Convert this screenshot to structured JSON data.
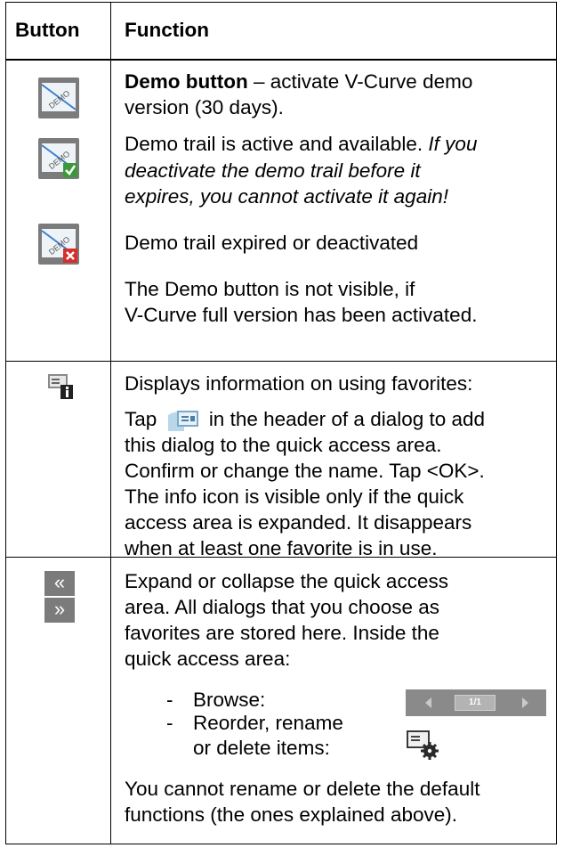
{
  "header": {
    "button_col": "Button",
    "function_col": "Function"
  },
  "demo": {
    "title": "Demo button",
    "title_rest": " – activate V-Curve demo",
    "title_line2": "version (30 days).",
    "active_line1": "Demo trail is active and available. ",
    "active_italic1": "If you",
    "active_line2": "deactivate the demo trail before it",
    "active_line3": "expires, you cannot activate it again!",
    "expired": "Demo trail expired or deactivated",
    "note_line1": "The Demo button is not visible, if",
    "note_line2": "V-Curve full version has been activated.",
    "icon_text": "DEMO"
  },
  "favorites": {
    "line1": "Displays information on using favorites:",
    "line2a": "Tap",
    "line2b": "in the header of a dialog to add",
    "line3": "this dialog to the quick access area.",
    "line4": "Confirm or change the name. Tap <OK>.",
    "line5": "The info icon is visible only if the quick",
    "line6": "access area is expanded. It disappears",
    "line7": "when at least one favorite is in use."
  },
  "quick_access": {
    "expand_glyph": "«",
    "collapse_glyph": "»",
    "line1": "Expand or collapse the quick access",
    "line2": "area. All dialogs that you choose as",
    "line3": "favorites are stored here. Inside the",
    "line4": "quick access area:",
    "dash": "-",
    "browse": "Browse:",
    "reorder1": "Reorder, rename",
    "reorder2": "or delete items:",
    "page_indicator": "1/1",
    "note1": "You cannot rename or delete the default",
    "note2": "functions (the ones explained above)."
  },
  "colors": {
    "icon_grey": "#7b7b7b",
    "check_green": "#3a9a3a",
    "x_red": "#d62d2d",
    "bar_grey": "#8a8a8a"
  }
}
